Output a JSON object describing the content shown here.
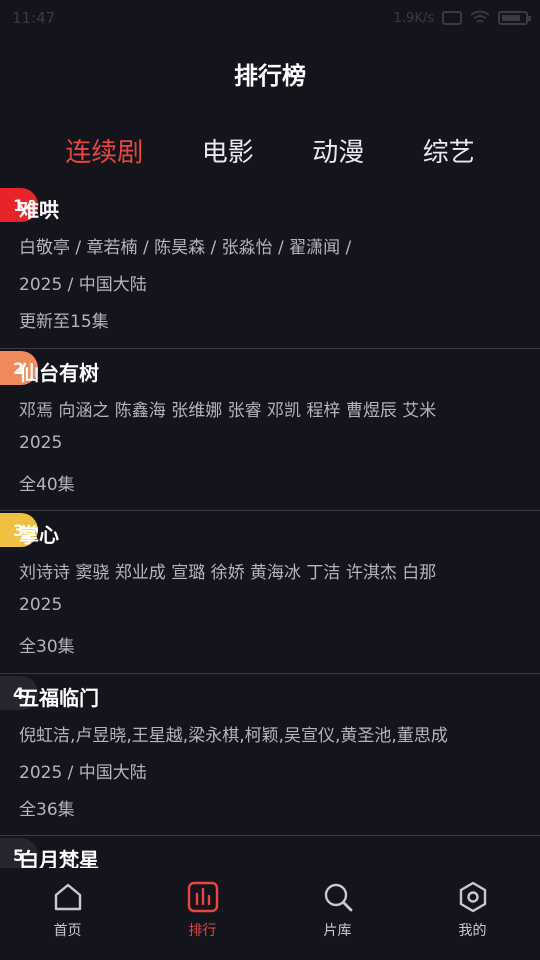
{
  "status_bar": {
    "time": "11:47",
    "network_speed": "1.9K/s",
    "battery": "battery-icon"
  },
  "header": {
    "title": "排行榜"
  },
  "tabs": [
    {
      "label": "连续剧",
      "active": true
    },
    {
      "label": "电影",
      "active": false
    },
    {
      "label": "动漫",
      "active": false
    },
    {
      "label": "综艺",
      "active": false
    }
  ],
  "list": [
    {
      "rank": "1",
      "title": "难哄",
      "cast": "白敬亭 / 章若楠 / 陈昊森 / 张淼怡 / 翟潇闻 /",
      "year": "2025 / 中国大陆",
      "episodes": "更新至15集",
      "badge_color": "#e8242a"
    },
    {
      "rank": "2",
      "title": "仙台有树",
      "cast": "邓焉 向涵之 陈鑫海 张维娜 张睿 邓凯 程梓 曹煜辰 艾米",
      "year": "2025",
      "episodes": "全40集",
      "badge_color": "#f08a5a"
    },
    {
      "rank": "3",
      "title": "掌心",
      "cast": "刘诗诗 窦骁 郑业成 宣璐 徐娇 黄海冰 丁洁 许淇杰 白那",
      "year": "2025",
      "episodes": "全30集",
      "badge_color": "#f0c040"
    },
    {
      "rank": "4",
      "title": "五福临门",
      "cast": "倪虹洁,卢昱晓,王星越,梁永棋,柯颖,吴宣仪,黄圣池,董思成",
      "year": "2025 / 中国大陆",
      "episodes": "全36集",
      "badge_color": "#26262e"
    },
    {
      "rank": "5",
      "title": "白月梵星",
      "cast": "",
      "year": "",
      "episodes": "",
      "badge_color": "#26262e"
    }
  ],
  "bottom_nav": [
    {
      "label": "首页",
      "icon": "home-icon",
      "active": false
    },
    {
      "label": "排行",
      "icon": "chart-icon",
      "active": true
    },
    {
      "label": "片库",
      "icon": "search-icon",
      "active": false
    },
    {
      "label": "我的",
      "icon": "profile-hexagon-icon",
      "active": false
    }
  ],
  "colors": {
    "background": "#14141c",
    "accent": "#e8463e",
    "secondary_text": "#b4b4bc"
  }
}
